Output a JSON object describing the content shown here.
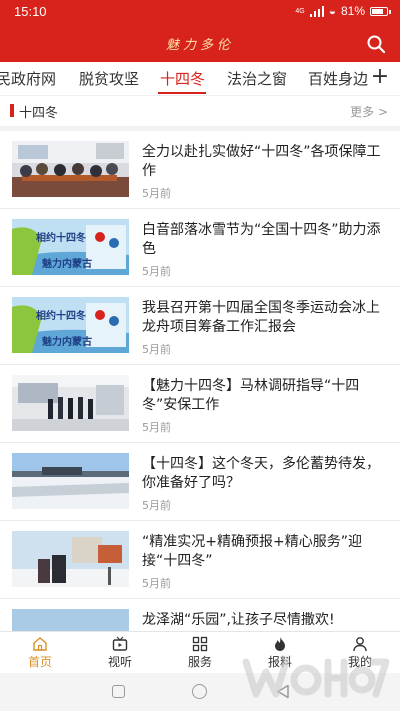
{
  "status_bar": {
    "time": "15:10",
    "network": "4G",
    "battery": "81%",
    "battery_level": 0.81
  },
  "header": {
    "title": "魅力多伦"
  },
  "tabs": [
    {
      "label": "民政府网"
    },
    {
      "label": "脱贫攻坚"
    },
    {
      "label": "十四冬",
      "active": true
    },
    {
      "label": "法治之窗"
    },
    {
      "label": "百姓身边"
    }
  ],
  "section": {
    "title": "十四冬",
    "more": "更多 >"
  },
  "news": [
    {
      "title": "全力以赴扎实做好“十四冬”各项保障工作",
      "time": "5月前",
      "image": "meeting-room-photo"
    },
    {
      "title": "白音部落冰雪节为“全国十四冬”助力添色",
      "time": "5月前",
      "image": "winter-games-poster",
      "banner_top": "相约十四冬",
      "banner_bottom": "魅力内蒙古"
    },
    {
      "title": "我县召开第十四届全国冬季运动会冰上龙舟项目筹备工作汇报会",
      "time": "5月前",
      "image": "winter-games-poster",
      "banner_top": "相约十四冬",
      "banner_bottom": "魅力内蒙古"
    },
    {
      "title": "【魅力十四冬】马林调研指导“十四冬”安保工作",
      "time": "5月前",
      "image": "inspection-photo"
    },
    {
      "title": "【十四冬】这个冬天，多伦蓄势待发，你准备好了吗？",
      "time": "5月前",
      "image": "snow-field-photo"
    },
    {
      "title": "“精准实况+精确预报+精心服务”迎接“十四冬”",
      "time": "5月前",
      "image": "weather-station-photo"
    },
    {
      "title": "龙泽湖“乐园”,让孩子尽情撒欢!",
      "time": "",
      "image": "lake-photo"
    }
  ],
  "bottom_nav": [
    {
      "label": "首页",
      "icon": "home-icon",
      "active": true
    },
    {
      "label": "视听",
      "icon": "tv-icon"
    },
    {
      "label": "服务",
      "icon": "grid-icon"
    },
    {
      "label": "报料",
      "icon": "flame-icon"
    },
    {
      "label": "我的",
      "icon": "person-icon"
    }
  ],
  "colors": {
    "brand": "#d8231c",
    "active_nav": "#d8902a"
  }
}
